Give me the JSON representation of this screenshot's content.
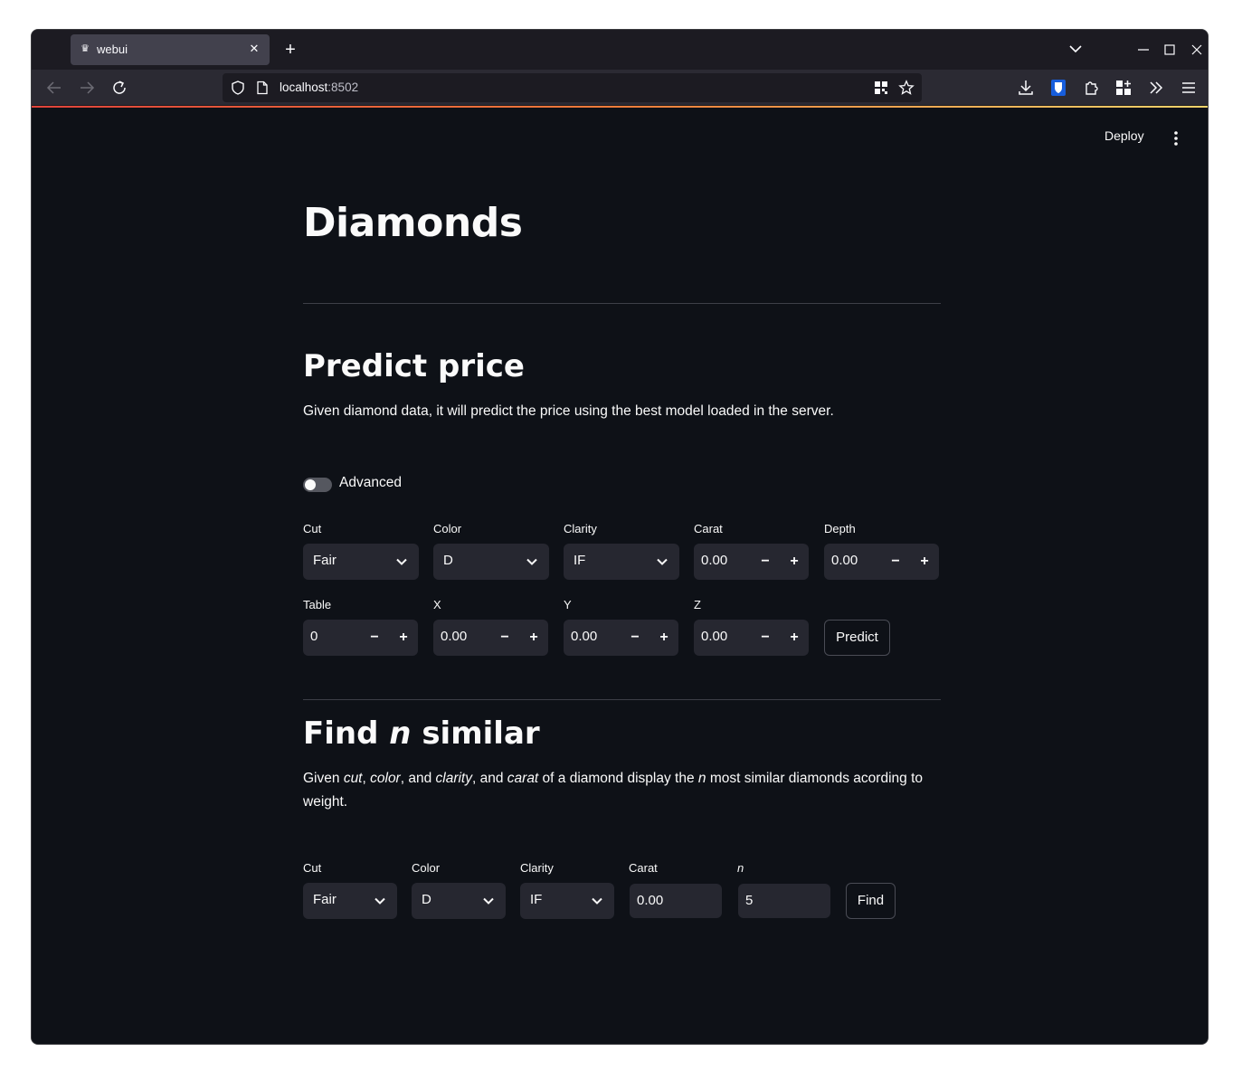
{
  "browser": {
    "tab_title": "webui",
    "url_host": "localhost",
    "url_port": ":8502"
  },
  "header": {
    "deploy_label": "Deploy"
  },
  "page": {
    "title": "Diamonds"
  },
  "predict": {
    "heading": "Predict price",
    "description": "Given diamond data, it will predict the price using the best model loaded in the server.",
    "advanced_label": "Advanced",
    "advanced_on": false,
    "cut_label": "Cut",
    "cut_value": "Fair",
    "color_label": "Color",
    "color_value": "D",
    "clarity_label": "Clarity",
    "clarity_value": "IF",
    "carat_label": "Carat",
    "carat_value": "0.00",
    "depth_label": "Depth",
    "depth_value": "0.00",
    "table_label": "Table",
    "table_value": "0",
    "x_label": "X",
    "x_value": "0.00",
    "y_label": "Y",
    "y_value": "0.00",
    "z_label": "Z",
    "z_value": "0.00",
    "button_label": "Predict"
  },
  "similar": {
    "heading_pre": "Find ",
    "heading_n": "n",
    "heading_post": " similar",
    "desc_given": "Given ",
    "desc_cut": "cut",
    "desc_sep1": ", ",
    "desc_color": "color",
    "desc_sep2": ", and ",
    "desc_clarity": "clarity",
    "desc_sep3": ", and ",
    "desc_carat": "carat",
    "desc_mid": " of a diamond display the ",
    "desc_n": "n",
    "desc_end": " most similar diamonds acording to weight.",
    "cut_label": "Cut",
    "cut_value": "Fair",
    "color_label": "Color",
    "color_value": "D",
    "clarity_label": "Clarity",
    "clarity_value": "IF",
    "carat_label": "Carat",
    "carat_value": "0.00",
    "n_label": "n",
    "n_value": "5",
    "button_label": "Find"
  }
}
